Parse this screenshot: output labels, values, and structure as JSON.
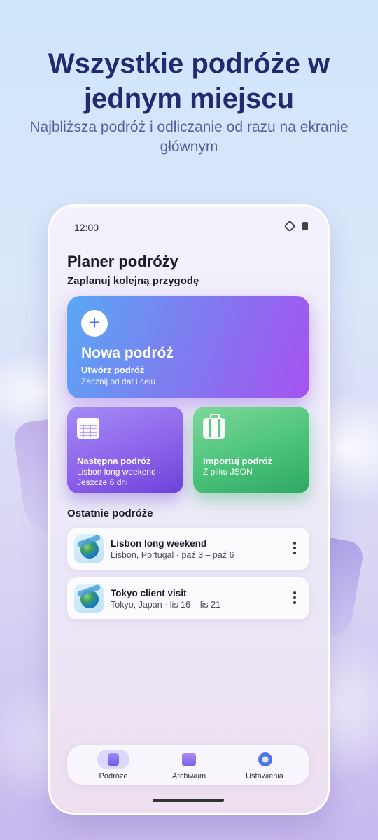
{
  "promo": {
    "headline": "Wszystkie podróże w jednym miejscu",
    "subheadline": "Najbliższa podróż i odliczanie od razu na ekranie głównym"
  },
  "status_bar": {
    "time": "12:00"
  },
  "app": {
    "title": "Planer podróży",
    "subtitle": "Zaplanuj kolejną przygodę"
  },
  "new_trip_card": {
    "icon": "plus-icon",
    "plus_glyph": "+",
    "title": "Nowa podróż",
    "label": "Utwórz podróż",
    "description": "Zacznij od dat i celu",
    "colors": [
      "#5aa8f5",
      "#a653f0"
    ]
  },
  "next_trip_card": {
    "icon": "calendar-icon",
    "title": "Następna podróż",
    "detail": "Lisbon long weekend · Jeszcze 6 dni"
  },
  "import_card": {
    "icon": "suitcase-icon",
    "title": "Importuj podróż",
    "detail": "Z pliku JSON"
  },
  "recent": {
    "section_title": "Ostatnie podróże",
    "trips": [
      {
        "name": "Lisbon long weekend",
        "meta": "Lisbon, Portugal · paź 3 – paź 6",
        "icon": "globe-plane-icon"
      },
      {
        "name": "Tokyo client visit",
        "meta": "Tokyo, Japan · lis 16 – lis 21",
        "icon": "globe-plane-icon"
      }
    ]
  },
  "bottom_nav": {
    "items": [
      {
        "label": "Podróże",
        "icon": "luggage-icon",
        "active": true
      },
      {
        "label": "Archiwum",
        "icon": "archive-box-icon",
        "active": false
      },
      {
        "label": "Ustawienia",
        "icon": "gear-icon",
        "active": false
      }
    ]
  }
}
